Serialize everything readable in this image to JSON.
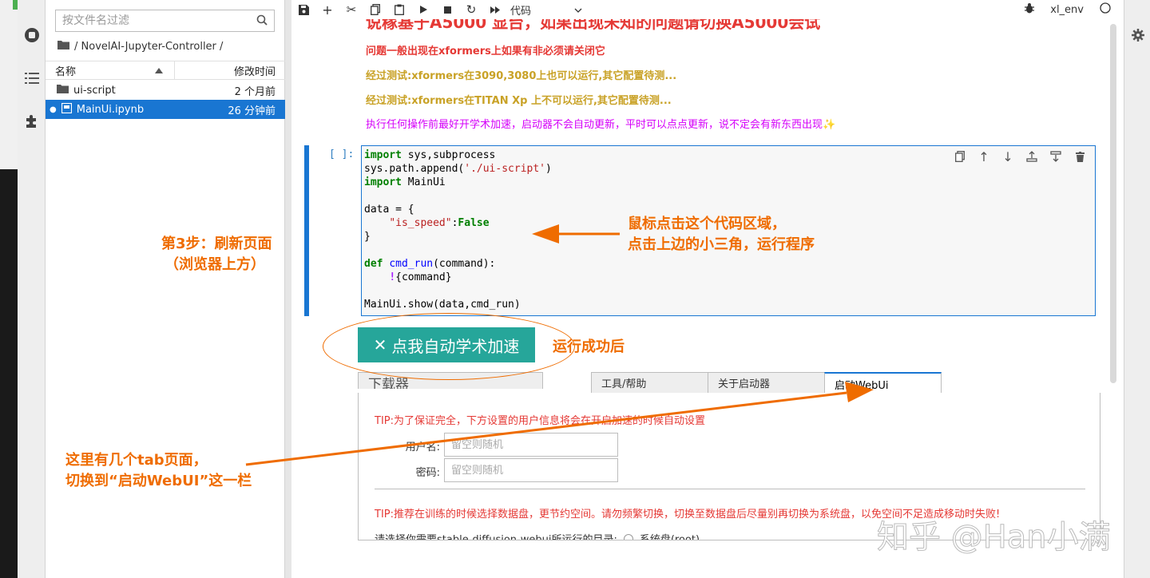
{
  "filebrowser": {
    "filter_placeholder": "按文件名过滤",
    "breadcrumb": "/ NovelAI-Jupyter-Controller /",
    "col_name": "名称",
    "col_modified": "修改时间",
    "files": [
      {
        "name": "ui-script",
        "type": "folder",
        "modified": "2 个月前"
      },
      {
        "name": "MainUi.ipynb",
        "type": "notebook",
        "modified": "26 分钟前"
      }
    ]
  },
  "toolbar": {
    "cell_type": "代码",
    "kernel_name": "xl_env"
  },
  "markdown": {
    "top_line": "说稼基于A5000 显台，如果出现未知的问题请切换A5000会试",
    "lines": [
      {
        "text": "问题一般出现在xformers上如果有非必须请关闭它",
        "color": "#e53935"
      },
      {
        "text": "经过测试:xformers在3090,3080上也可以运行,其它配置待测...",
        "color": "#c9a227"
      },
      {
        "text": "经过测试:xformers在TITAN Xp 上不可以运行,其它配置待测...",
        "color": "#c9a227"
      },
      {
        "text": "执行任何操作前最好开学术加速，启动器不会自动更新，平时可以点点更新，说不定会有新东西出现✨",
        "color": "#d500f9"
      }
    ]
  },
  "cell": {
    "prompt": "[ ]:",
    "code_lines": [
      "import sys,subprocess",
      "sys.path.append('./ui-script')",
      "import MainUi",
      "",
      "data = {",
      "    \"is_speed\":False",
      "}",
      "",
      "def cmd_run(command):",
      "    !{command}",
      "",
      "MainUi.show(data,cmd_run)"
    ]
  },
  "output": {
    "accel_button": "点我自动学术加速",
    "tabs": [
      "下载器",
      "工具/帮助",
      "关于启动器",
      "启动WebUi"
    ],
    "active_tab": "启动WebUi",
    "tip1": "TIP:为了保证完全，下方设置的用户信息将会在开启加速的时候自动设置",
    "username_label": "用户名:",
    "username_placeholder": "留空则随机",
    "password_label": "密码:",
    "password_placeholder": "留空则随机",
    "tip2": "TIP:推荐在训练的时候选择数据盘，更节约空间。请勿频繁切换，切换至数据盘后尽量别再切换为系统盘，以免空间不足造成移动时失败!",
    "dir_prompt": "请选择你需要stable-diffusion-webui所运行的目录:",
    "dir_option": "系统盘(root)"
  },
  "annotations": {
    "step3_line1": "第3步：刷新页面",
    "step3_line2": "（浏览器上方）",
    "click_line1": "鼠标点击这个代码区域，",
    "click_line2": "点击上边的小三角，运行程序",
    "run_success": "运行成功后",
    "tabs_line1": "这里有几个tab页面，",
    "tabs_line2": "切换到“启动WebUI”这一栏",
    "accent_color": "#ef6c00"
  },
  "watermark": "知乎 @Han小满"
}
